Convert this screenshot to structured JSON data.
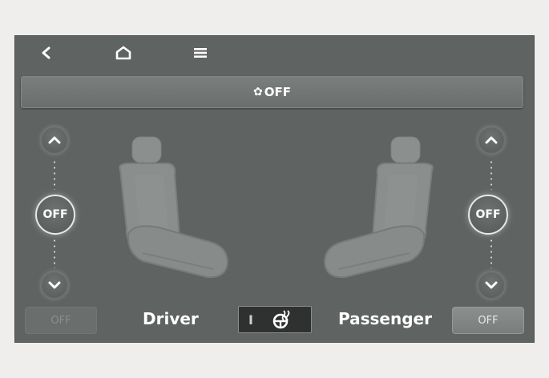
{
  "nav": {
    "back_icon": "back-arrow-icon",
    "home_icon": "home-icon",
    "menu_icon": "menu-icon"
  },
  "fan": {
    "icon": "fan-icon",
    "status": "OFF"
  },
  "driver": {
    "level_display": "OFF",
    "off_button": "OFF",
    "label": "Driver"
  },
  "passenger": {
    "level_display": "OFF",
    "off_button": "OFF",
    "label": "Passenger"
  },
  "mode_toggle": {
    "left_mark": "I",
    "icon": "heated-steering-icon"
  },
  "colors": {
    "screen_bg": "#5f6361",
    "text": "#ffffff",
    "accent_border": "#e8e8e8"
  }
}
